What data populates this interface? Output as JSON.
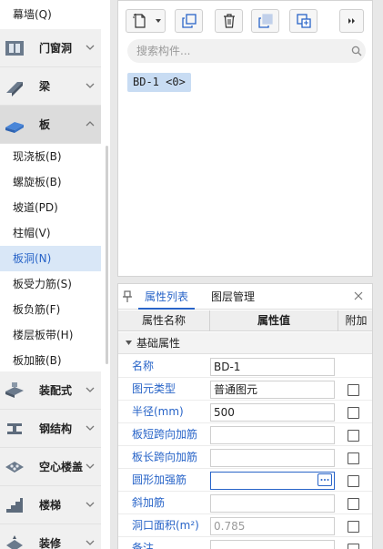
{
  "nav": {
    "top_item": "幕墙(Q)",
    "groups": [
      {
        "label": "门窗洞",
        "icon": "door-window-icon"
      },
      {
        "label": "梁",
        "icon": "beam-icon"
      },
      {
        "label": "板",
        "icon": "slab-icon",
        "expanded": true
      },
      {
        "label": "装配式",
        "icon": "prefab-icon"
      },
      {
        "label": "钢结构",
        "icon": "steel-structure-icon"
      },
      {
        "label": "空心楼盖",
        "icon": "hollow-floor-icon"
      },
      {
        "label": "楼梯",
        "icon": "stair-icon"
      },
      {
        "label": "装修",
        "icon": "decoration-icon"
      }
    ],
    "subitems": [
      "现浇板(B)",
      "螺旋板(B)",
      "坡道(PD)",
      "柱帽(V)",
      "板洞(N)",
      "板受力筋(S)",
      "板负筋(F)",
      "楼层板带(H)",
      "板加腋(B)"
    ],
    "selected_subitem": "板洞(N)"
  },
  "component_panel": {
    "toolbar": [
      "new-component-icon",
      "copy-icon",
      "delete-icon",
      "duplicate-layer-icon",
      "layer-copy-icon",
      "expand-more-icon"
    ],
    "search_placeholder": "搜索构件...",
    "items": [
      "BD-1 <0>"
    ]
  },
  "property_panel": {
    "tabs": [
      "属性列表",
      "图层管理"
    ],
    "active_tab": "属性列表",
    "columns": [
      "属性名称",
      "属性值",
      "附加"
    ],
    "section": "基础属性",
    "rows": [
      {
        "name": "名称",
        "value": "BD-1",
        "checkbox": false
      },
      {
        "name": "图元类型",
        "value": "普通图元",
        "checkbox": true
      },
      {
        "name": "半径(mm)",
        "value": "500",
        "checkbox": true
      },
      {
        "name": "板短跨向加筋",
        "value": "",
        "checkbox": true
      },
      {
        "name": "板长跨向加筋",
        "value": "",
        "checkbox": true
      },
      {
        "name": "圆形加强筋",
        "value": "",
        "checkbox": true,
        "editing": true
      },
      {
        "name": "斜加筋",
        "value": "",
        "checkbox": true
      },
      {
        "name": "洞口面积(m²)",
        "value": "0.785",
        "checkbox": true,
        "dim": true
      },
      {
        "name": "备注",
        "value": "",
        "checkbox": true
      }
    ]
  },
  "colors": {
    "accent": "#2864c8",
    "selected_bg": "#d9e7f7",
    "group_bg": "#f0f0f0"
  }
}
